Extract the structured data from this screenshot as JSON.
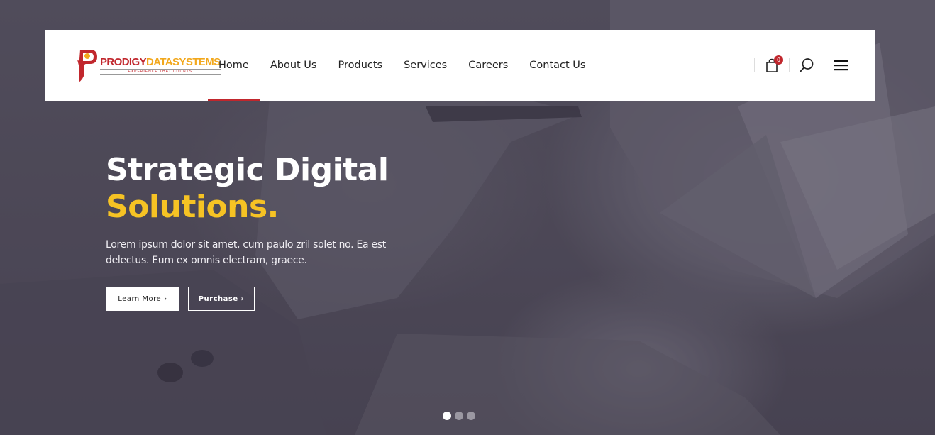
{
  "brand": {
    "name_part1": "PRODIGY",
    "name_part2": "DATASYSTEMS",
    "tagline": "EXPERIENCE THAT COUNTS",
    "colors": {
      "red": "#c1272d",
      "gold": "#f2a81d"
    }
  },
  "nav": {
    "items": [
      {
        "label": "Home",
        "active": true
      },
      {
        "label": "About Us"
      },
      {
        "label": "Products"
      },
      {
        "label": "Services"
      },
      {
        "label": "Careers"
      },
      {
        "label": "Contact Us"
      }
    ]
  },
  "tools": {
    "cart_icon": "shopping-bag-icon",
    "cart_count": "0",
    "search_icon": "search-icon",
    "menu_icon": "hamburger-menu-icon"
  },
  "hero": {
    "title_line1": "Strategic Digital",
    "title_line2": "Solutions.",
    "text": "Lorem ipsum dolor sit amet, cum paulo zril solet no. Ea est delectus. Eum ex omnis electram, graece.",
    "learn_more_label": "Learn More",
    "purchase_label": "Purchase",
    "accent_color": "#f6c324"
  },
  "slider": {
    "slides": 3,
    "active": 1
  }
}
